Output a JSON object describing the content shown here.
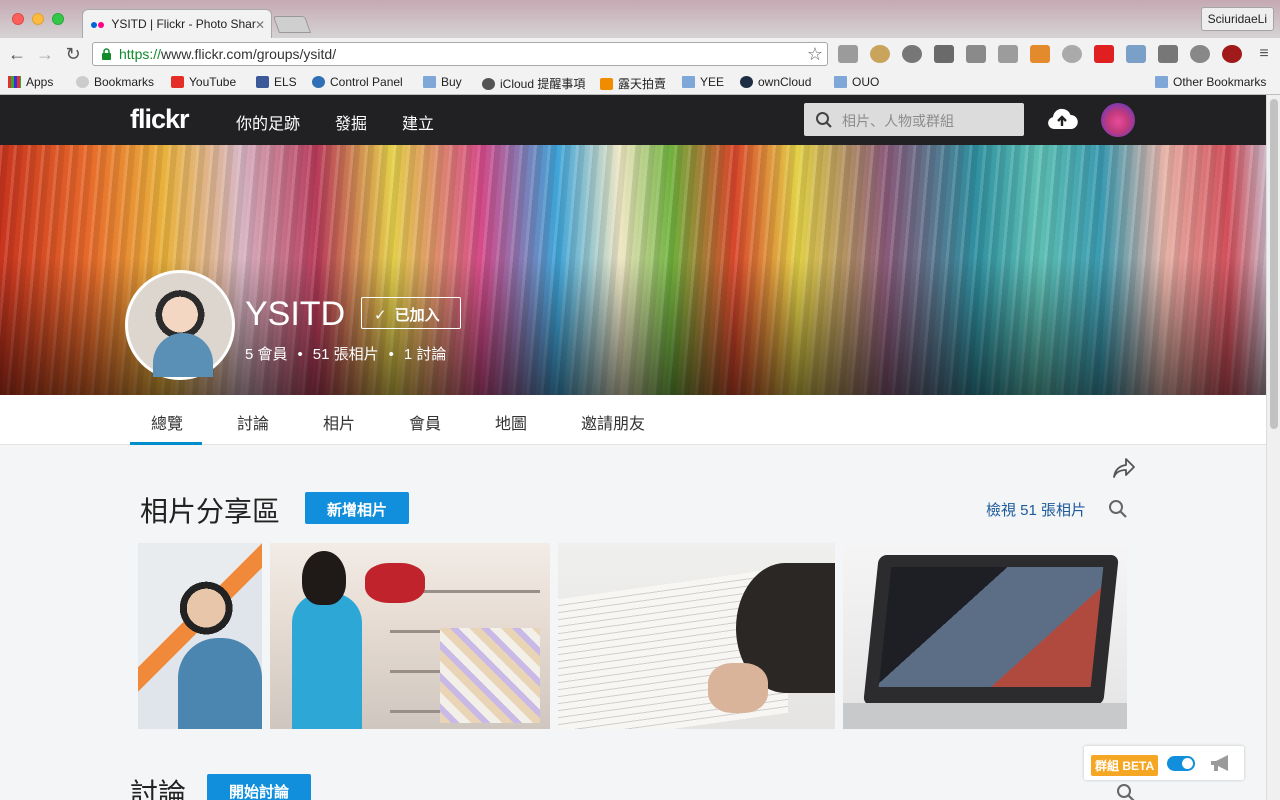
{
  "browser": {
    "tab_title": "YSITD | Flickr - Photo Shar",
    "profile_name": "SciuridaeLi",
    "url_https": "https://",
    "url_rest": "www.flickr.com/groups/ysitd/",
    "bookmarks": [
      "Apps",
      "Bookmarks",
      "YouTube",
      "ELS",
      "Control Panel",
      "Buy",
      "iCloud 提醒事項",
      "露天拍賣",
      "YEE",
      "ownCloud",
      "OUO",
      "Other Bookmarks"
    ]
  },
  "flickr_nav": {
    "logo": "flickr",
    "items": [
      "你的足跡",
      "發掘",
      "建立"
    ],
    "search_placeholder": "相片、人物或群組"
  },
  "group": {
    "name": "YSITD",
    "joined_label": "已加入",
    "members": "5 會員",
    "photos": "51 張相片",
    "discussions": "1 討論"
  },
  "subnav": {
    "tabs": [
      "總覽",
      "討論",
      "相片",
      "會員",
      "地圖",
      "邀請朋友"
    ],
    "active": "總覽"
  },
  "photo_section": {
    "title": "相片分享區",
    "add_button": "新增相片",
    "view_all": "檢視 51 張相片"
  },
  "discussion_section": {
    "title": "討論",
    "start_button": "開始討論"
  },
  "beta": {
    "label": "群組 BETA",
    "enabled": true
  },
  "colors": {
    "flickr_nav_bg": "#212124",
    "accent_blue": "#128fdc",
    "beta_orange": "#f5a623"
  }
}
